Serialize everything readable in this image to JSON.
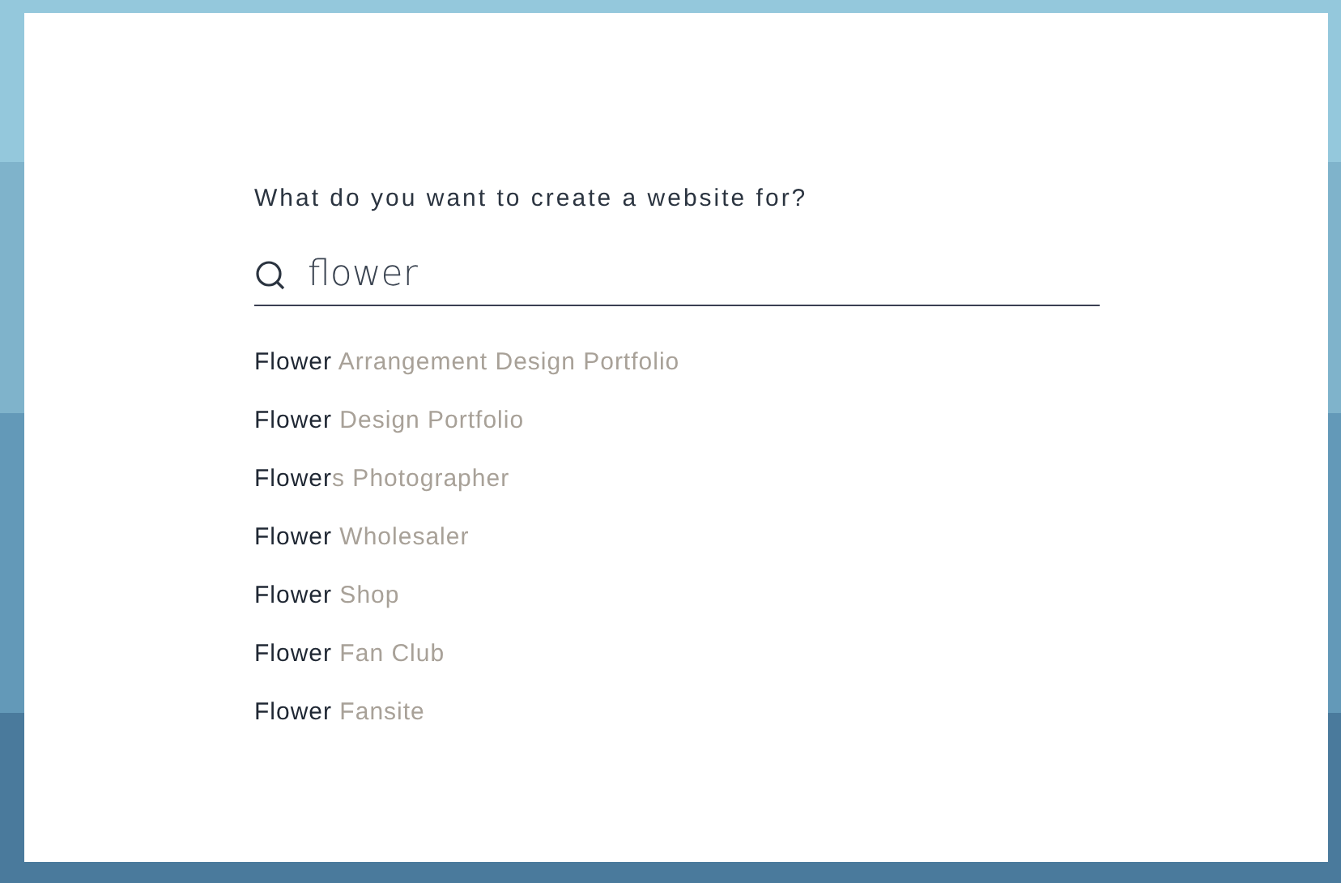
{
  "prompt": "What do you want to create a website for?",
  "search": {
    "value": "flower"
  },
  "suggestions": [
    {
      "match": "Flower",
      "rest": " Arrangement Design Portfolio"
    },
    {
      "match": "Flower",
      "rest": " Design Portfolio"
    },
    {
      "match": "Flower",
      "rest": "s Photographer"
    },
    {
      "match": "Flower",
      "rest": " Wholesaler"
    },
    {
      "match": "Flower",
      "rest": " Shop"
    },
    {
      "match": "Flower",
      "rest": " Fan Club"
    },
    {
      "match": "Flower",
      "rest": " Fansite"
    }
  ]
}
